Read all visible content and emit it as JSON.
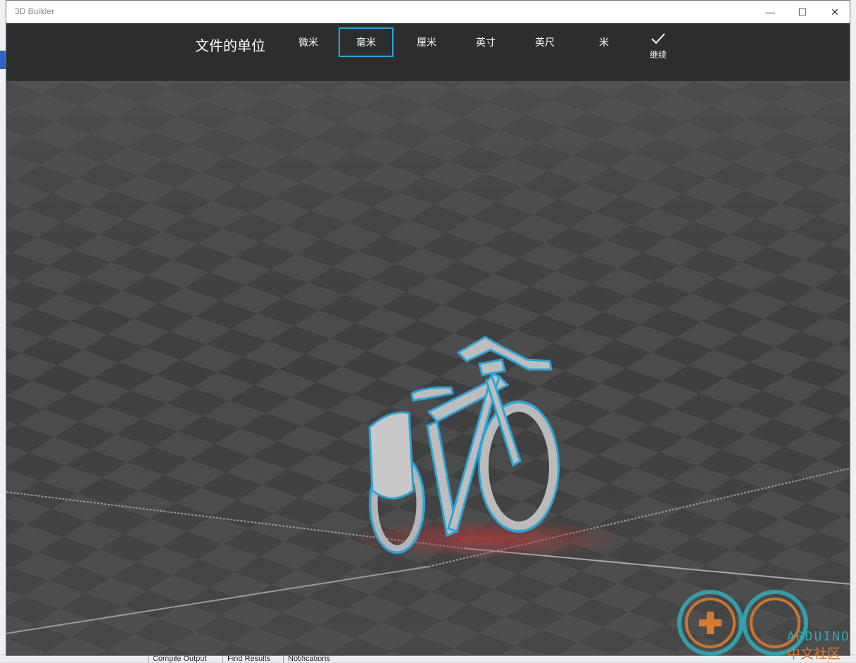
{
  "window": {
    "title": "3D Builder",
    "minimize_icon": "—",
    "maximize_icon": "☐",
    "close_icon": "✕"
  },
  "toolbar": {
    "label": "文件的单位",
    "units": [
      {
        "label": "微米",
        "selected": false
      },
      {
        "label": "毫米",
        "selected": true
      },
      {
        "label": "厘米",
        "selected": false
      },
      {
        "label": "英寸",
        "selected": false
      },
      {
        "label": "英尺",
        "selected": false
      },
      {
        "label": "米",
        "selected": false
      }
    ],
    "continue_label": "继续",
    "continue_icon": "checkmark-icon"
  },
  "viewport": {
    "model": "bicycle",
    "highlight_color": "#29a5d8",
    "shadow_color": "#b03a3a"
  },
  "background_app": {
    "tabs": [
      "Compile Output",
      "Find Results",
      "Notifications"
    ]
  },
  "watermark": {
    "line1": "ARDUINO",
    "line2": "中文社区"
  },
  "colors": {
    "toolbar_bg": "#2c2d2d",
    "selected_border": "#29a5d8",
    "canvas_bg": "#4a4a4a"
  }
}
